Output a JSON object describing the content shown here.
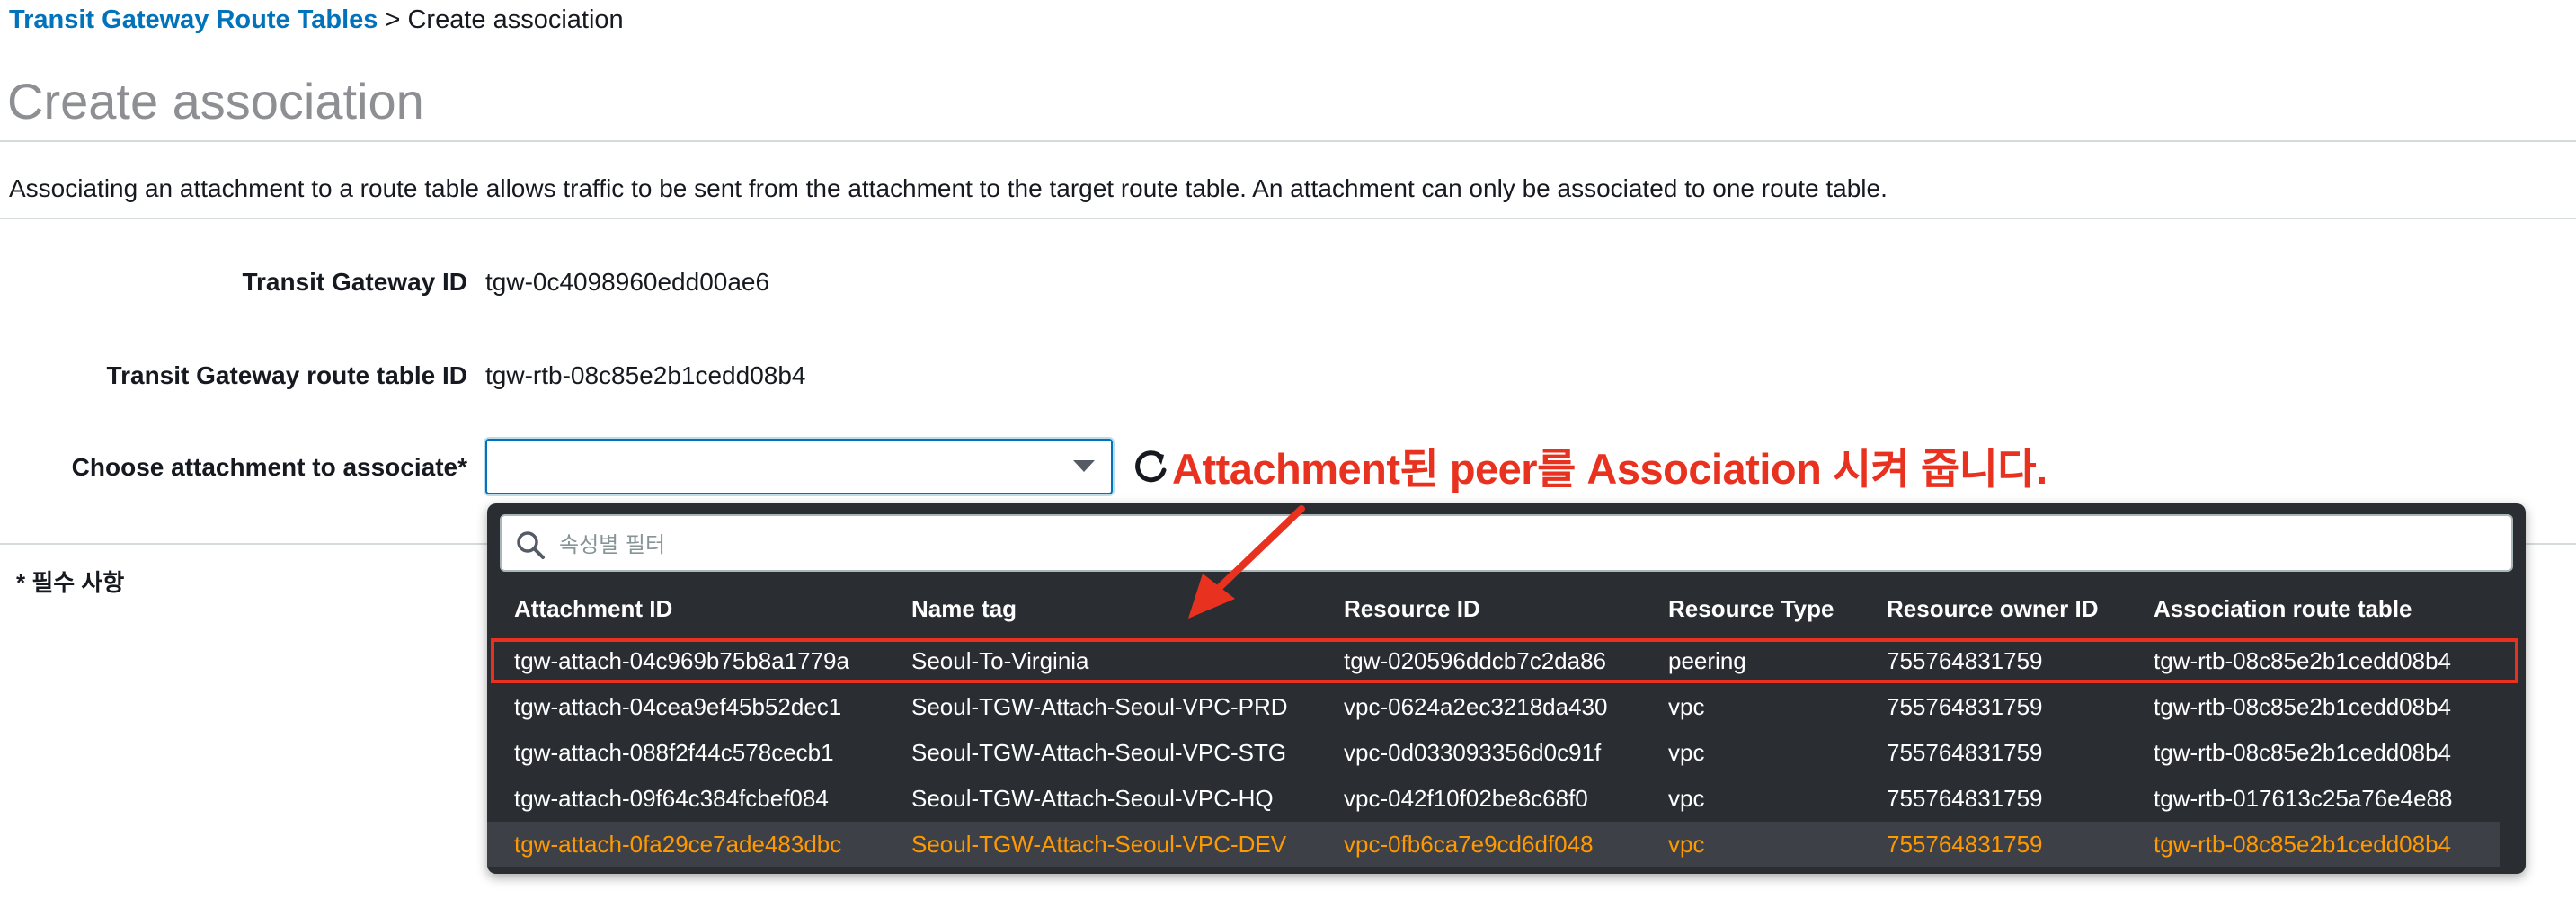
{
  "breadcrumb": {
    "link_label": "Transit Gateway Route Tables",
    "separator": ">",
    "current": "Create association"
  },
  "page": {
    "title": "Create association",
    "description": "Associating an attachment to a route table allows traffic to be sent from the attachment to the target route table. An attachment can only be associated to one route table."
  },
  "form": {
    "tgw_id_label": "Transit Gateway ID",
    "tgw_id_value": "tgw-0c4098960edd00ae6",
    "rtb_id_label": "Transit Gateway route table ID",
    "rtb_id_value": "tgw-rtb-08c85e2b1cedd08b4",
    "attachment_label": "Choose attachment to associate*",
    "attachment_value": "",
    "required_note": "* 필수 사항"
  },
  "annotation": {
    "text": "Attachment된 peer를 Association 시켜 줍니다.",
    "color": "#e8321f"
  },
  "dropdown": {
    "filter_placeholder": "속성별 필터",
    "columns": [
      "Attachment ID",
      "Name tag",
      "Resource ID",
      "Resource Type",
      "Resource owner ID",
      "Association route table"
    ],
    "rows": [
      [
        "tgw-attach-04c969b75b8a1779a",
        "Seoul-To-Virginia",
        "tgw-020596ddcb7c2da86",
        "peering",
        "755764831759",
        "tgw-rtb-08c85e2b1cedd08b4"
      ],
      [
        "tgw-attach-04cea9ef45b52dec1",
        "Seoul-TGW-Attach-Seoul-VPC-PRD",
        "vpc-0624a2ec3218da430",
        "vpc",
        "755764831759",
        "tgw-rtb-08c85e2b1cedd08b4"
      ],
      [
        "tgw-attach-088f2f44c578cecb1",
        "Seoul-TGW-Attach-Seoul-VPC-STG",
        "vpc-0d033093356d0c91f",
        "vpc",
        "755764831759",
        "tgw-rtb-08c85e2b1cedd08b4"
      ],
      [
        "tgw-attach-09f64c384fcbef084",
        "Seoul-TGW-Attach-Seoul-VPC-HQ",
        "vpc-042f10f02be8c68f0",
        "vpc",
        "755764831759",
        "tgw-rtb-017613c25a76e4e88"
      ],
      [
        "tgw-attach-0fa29ce7ade483dbc",
        "Seoul-TGW-Attach-Seoul-VPC-DEV",
        "vpc-0fb6ca7e9cd6df048",
        "vpc",
        "755764831759",
        "tgw-rtb-08c85e2b1cedd08b4"
      ]
    ],
    "boxed_row_index": 0,
    "hover_row_index": 4,
    "hover_color": "#ff9900"
  },
  "colors": {
    "link": "#0073bb",
    "dropdown_bg": "#2a2e33",
    "highlight_box": "#e8321f"
  }
}
